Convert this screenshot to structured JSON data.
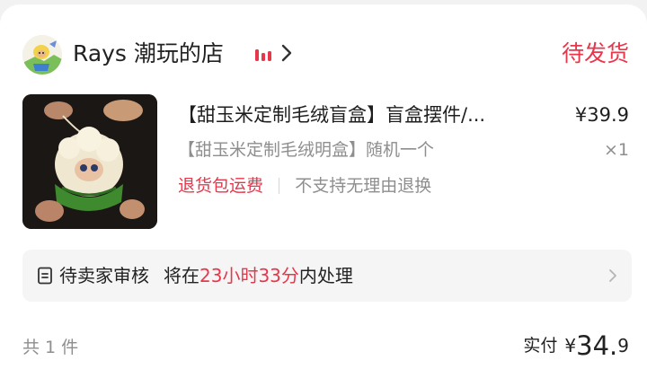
{
  "shop": {
    "name": "Rays 潮玩的店",
    "status": "待发货",
    "avatar_icon": "shop-avatar-illustration",
    "live_icon": "live-bars-icon",
    "accent_color": "#e8364a"
  },
  "product": {
    "title": "【甜玉米定制毛绒盲盒】盲盒摆件/...",
    "price": "¥39.9",
    "spec": "【甜玉米定制毛绒明盒】随机一个",
    "qty": "×1",
    "tag_return": "退货包运费",
    "tag_noreason": "不支持无理由退换"
  },
  "review": {
    "label": "待卖家审核",
    "prefix": "将在",
    "deadline": "23小时33分",
    "suffix": "内处理"
  },
  "footer": {
    "count": "共 1 件",
    "paid_label": "实付",
    "paid_symbol": "¥",
    "paid_int": "34.",
    "paid_dec": "9"
  }
}
